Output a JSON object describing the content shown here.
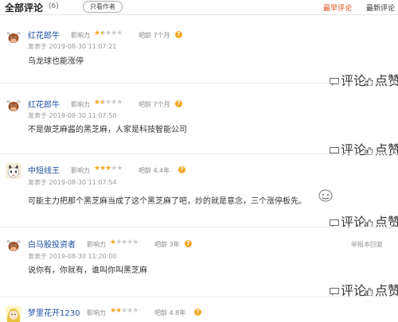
{
  "header": {
    "title": "全部评论",
    "count": "(6)",
    "filter_label": "只看作者",
    "sort_hot": "最早评论",
    "sort_new": "最新评论"
  },
  "labels": {
    "influence": "影响力",
    "age_prefix": "吧龄",
    "post_prefix": "发表于",
    "reply": "评论",
    "like": "点赞",
    "report": "举报本回复"
  },
  "colors": {
    "accent": "#e14b10",
    "username": "#1e50a2",
    "star": "#f5a623"
  },
  "comments": [
    {
      "user": "红花郎牛",
      "stars": 1.5,
      "age": "7个月",
      "time": "2019-08-30 11:07:21",
      "text": "乌龙球也能涨停",
      "avatar": "bull"
    },
    {
      "user": "红花郎牛",
      "stars": 1.5,
      "age": "7个月",
      "time": "2019-08-30 11:07:50",
      "text": "不是做芝麻酱的黑芝麻，人家是科技智能公司",
      "avatar": "bull"
    },
    {
      "user": "中短线王",
      "stars": 3,
      "age": "4.4年",
      "time": "2019-08-30 11:07:54",
      "text": "可能主力把那个黑芝麻当成了这个黑芝麻了吧，炒的就是意念，三个涨停板先。",
      "avatar": "cat"
    },
    {
      "user": "白马股投资者",
      "stars": 1,
      "age": "3年",
      "time": "2019-08-30 11:20:00",
      "text": "说你有，你就有，谁叫你叫黑芝麻",
      "avatar": "bull"
    },
    {
      "user": "梦里花开1230",
      "stars": 2,
      "age": "4.8年",
      "time": "",
      "text": "",
      "avatar": "girl"
    }
  ]
}
